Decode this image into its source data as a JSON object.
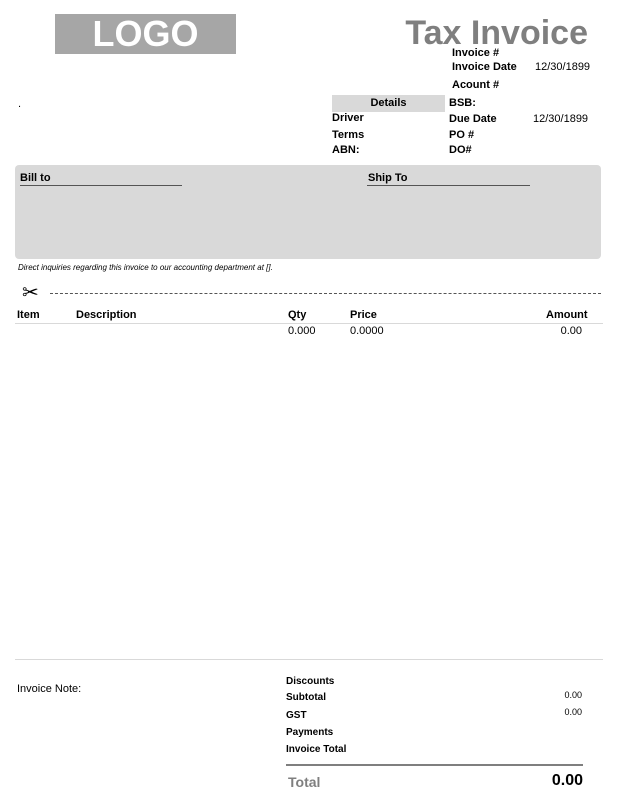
{
  "header": {
    "logo": "LOGO",
    "title": "Tax Invoice",
    "dot": "."
  },
  "invoice_meta": {
    "invoice_no_label": "Invoice #",
    "invoice_date_label": "Invoice Date",
    "invoice_date_value": "12/30/1899",
    "account_label": "Acount #",
    "bsb_label": "BSB:",
    "due_date_label": "Due Date",
    "due_date_value": "12/30/1899",
    "po_label": "PO #",
    "do_label": "DO#"
  },
  "details": {
    "header": "Details",
    "driver_label": "Driver",
    "terms_label": "Terms",
    "abn_label": "ABN:"
  },
  "address": {
    "bill_to": "Bill to",
    "ship_to": "Ship To"
  },
  "inquiry_note": "Direct inquiries regarding this invoice to our accounting department at [].",
  "scissors_icon": "scissors-icon",
  "items_table": {
    "columns": [
      "Item",
      "Description",
      "Qty",
      "Price",
      "Amount"
    ],
    "rows": [
      {
        "item": "",
        "description": "",
        "qty": "0.000",
        "price": "0.0000",
        "amount": "0.00"
      }
    ]
  },
  "totals": {
    "invoice_note_label": "Invoice Note:",
    "discounts_label": "Discounts",
    "subtotal_label": "Subtotal",
    "subtotal_value": "0.00",
    "gst_label": "GST",
    "gst_value": "0.00",
    "payments_label": "Payments",
    "invoice_total_label": "Invoice Total",
    "total_label": "Total",
    "total_value": "0.00"
  }
}
